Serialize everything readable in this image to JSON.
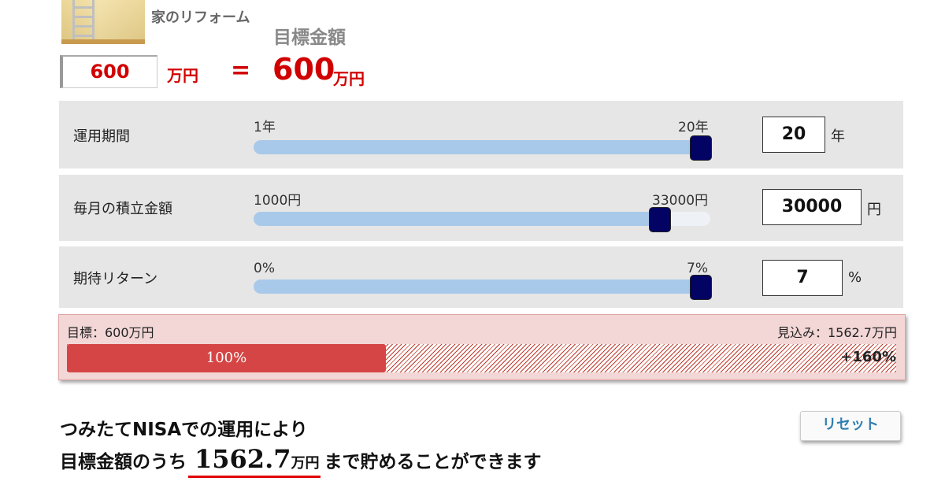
{
  "header": {
    "category_label": "家のリフォーム",
    "target_heading": "目標金額",
    "thumbnail_icon": "ladder-room-photo"
  },
  "target": {
    "input_value": "600",
    "input_unit": "万円",
    "equals": "=",
    "result_value": "600",
    "result_unit": "万円",
    "accent_color": "#d10000"
  },
  "params": {
    "period": {
      "label": "運用期間",
      "min_label": "1年",
      "max_label": "20年",
      "min": 1,
      "max": 20,
      "value": 20,
      "input_value": "20",
      "unit": "年"
    },
    "monthly": {
      "label": "毎月の積立金額",
      "min_label": "1000円",
      "max_label": "33000円",
      "min": 1000,
      "max": 33000,
      "value": 30000,
      "input_value": "30000",
      "unit": "円"
    },
    "return": {
      "label": "期待リターン",
      "min_label": "0%",
      "max_label": "7%",
      "min": 0,
      "max": 7,
      "value": 7,
      "input_value": "7",
      "unit": "%"
    }
  },
  "progress": {
    "goal_text": "目標：600万円",
    "forecast_text": "見込み：1562.7万円",
    "fill_label": "100%",
    "over_label": "+160%",
    "fill_fraction": 0.385,
    "bar_color": "#d64545"
  },
  "message": {
    "line1": "つみたてNISAでの運用により",
    "line2_prefix": "目標金額のうち",
    "amount": "1562.7",
    "amount_unit": "万円",
    "line2_suffix": "まで貯めることができます"
  },
  "reset": {
    "label": "リセット"
  }
}
